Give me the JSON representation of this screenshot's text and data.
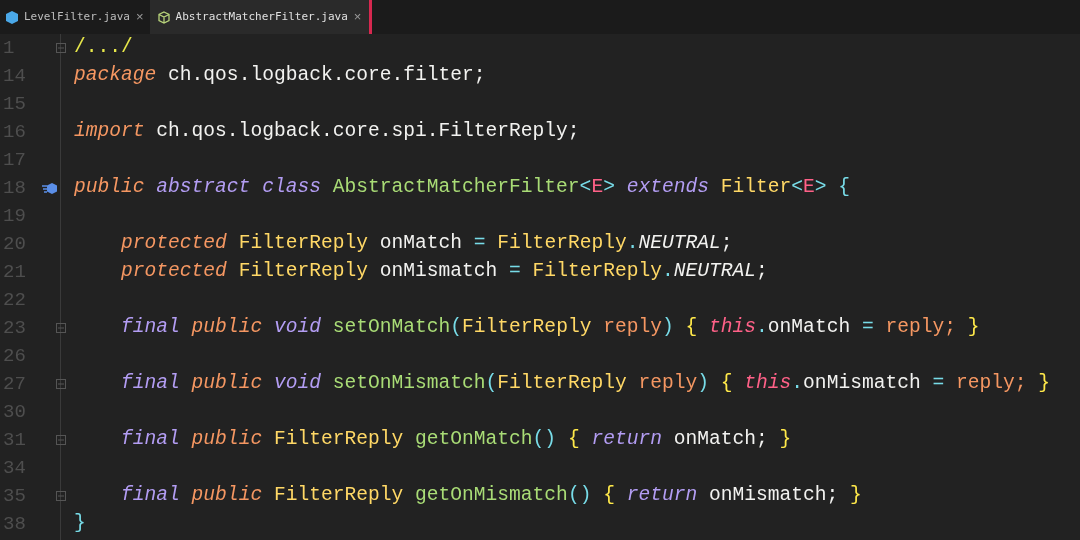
{
  "tabs": [
    {
      "label": "LevelFilter.java",
      "kind": "filled",
      "close": "×",
      "selected": false
    },
    {
      "label": "AbstractMatcherFilter.java",
      "kind": "outline",
      "close": "×",
      "selected": true
    }
  ],
  "lines": [
    {
      "num": "1",
      "fold": true,
      "tokens": [
        {
          "kind": "fold",
          "t": "/.../"
        }
      ]
    },
    {
      "num": "14",
      "tokens": [
        {
          "kind": "kw",
          "t": "package "
        },
        {
          "kind": "id",
          "t": "ch.qos.logback.core.filter;"
        }
      ]
    },
    {
      "num": "15"
    },
    {
      "num": "16",
      "tokens": [
        {
          "kind": "kw",
          "t": "import "
        },
        {
          "kind": "id",
          "t": "ch.qos.logback.core.spi.FilterReply;"
        }
      ]
    },
    {
      "num": "17"
    },
    {
      "num": "18",
      "marker": true,
      "tokens": [
        {
          "kind": "kw",
          "t": "public "
        },
        {
          "kind": "mod",
          "t": "abstract class "
        },
        {
          "kind": "cls",
          "t": "AbstractMatcherFilter"
        },
        {
          "kind": "op",
          "t": "<"
        },
        {
          "kind": "tp",
          "t": "E"
        },
        {
          "kind": "op",
          "t": "> "
        },
        {
          "kind": "mod",
          "t": "extends "
        },
        {
          "kind": "type",
          "t": "Filter"
        },
        {
          "kind": "op",
          "t": "<"
        },
        {
          "kind": "tp",
          "t": "E"
        },
        {
          "kind": "op",
          "t": "> {"
        }
      ]
    },
    {
      "num": "19"
    },
    {
      "num": "20",
      "tokens": [
        {
          "kind": "kw",
          "t": "    protected "
        },
        {
          "kind": "type",
          "t": "FilterReply "
        },
        {
          "kind": "id",
          "t": "onMatch "
        },
        {
          "kind": "op",
          "t": "= "
        },
        {
          "kind": "type",
          "t": "FilterReply"
        },
        {
          "kind": "op",
          "t": "."
        },
        {
          "kind": "const",
          "t": "NEUTRAL"
        },
        {
          "kind": "id",
          "t": ";"
        }
      ]
    },
    {
      "num": "21",
      "tokens": [
        {
          "kind": "kw",
          "t": "    protected "
        },
        {
          "kind": "type",
          "t": "FilterReply "
        },
        {
          "kind": "id",
          "t": "onMismatch "
        },
        {
          "kind": "op",
          "t": "= "
        },
        {
          "kind": "type",
          "t": "FilterReply"
        },
        {
          "kind": "op",
          "t": "."
        },
        {
          "kind": "const",
          "t": "NEUTRAL"
        },
        {
          "kind": "id",
          "t": ";"
        }
      ]
    },
    {
      "num": "22"
    },
    {
      "num": "23",
      "fold": true,
      "tokens": [
        {
          "kind": "mod",
          "t": "    final "
        },
        {
          "kind": "kw",
          "t": "public "
        },
        {
          "kind": "mod",
          "t": "void "
        },
        {
          "kind": "cls",
          "t": "setOnMatch"
        },
        {
          "kind": "op",
          "t": "("
        },
        {
          "kind": "type",
          "t": "FilterReply "
        },
        {
          "kind": "param",
          "t": "reply"
        },
        {
          "kind": "op",
          "t": ") "
        },
        {
          "kind": "brace",
          "t": "{ "
        },
        {
          "kind": "this",
          "t": "this"
        },
        {
          "kind": "op",
          "t": "."
        },
        {
          "kind": "id",
          "t": "onMatch "
        },
        {
          "kind": "op",
          "t": "= "
        },
        {
          "kind": "param",
          "t": "reply; "
        },
        {
          "kind": "brace",
          "t": "}"
        }
      ]
    },
    {
      "num": "26"
    },
    {
      "num": "27",
      "fold": true,
      "tokens": [
        {
          "kind": "mod",
          "t": "    final "
        },
        {
          "kind": "kw",
          "t": "public "
        },
        {
          "kind": "mod",
          "t": "void "
        },
        {
          "kind": "cls",
          "t": "setOnMismatch"
        },
        {
          "kind": "op",
          "t": "("
        },
        {
          "kind": "type",
          "t": "FilterReply "
        },
        {
          "kind": "param",
          "t": "reply"
        },
        {
          "kind": "op",
          "t": ") "
        },
        {
          "kind": "brace",
          "t": "{ "
        },
        {
          "kind": "this",
          "t": "this"
        },
        {
          "kind": "op",
          "t": "."
        },
        {
          "kind": "id",
          "t": "onMismatch "
        },
        {
          "kind": "op",
          "t": "= "
        },
        {
          "kind": "param",
          "t": "reply; "
        },
        {
          "kind": "brace",
          "t": "}"
        }
      ]
    },
    {
      "num": "30"
    },
    {
      "num": "31",
      "fold": true,
      "tokens": [
        {
          "kind": "mod",
          "t": "    final "
        },
        {
          "kind": "kw",
          "t": "public "
        },
        {
          "kind": "type",
          "t": "FilterReply "
        },
        {
          "kind": "cls",
          "t": "getOnMatch"
        },
        {
          "kind": "op",
          "t": "() "
        },
        {
          "kind": "brace",
          "t": "{ "
        },
        {
          "kind": "mod",
          "t": "return "
        },
        {
          "kind": "id",
          "t": "onMatch; "
        },
        {
          "kind": "brace",
          "t": "}"
        }
      ]
    },
    {
      "num": "34"
    },
    {
      "num": "35",
      "fold": true,
      "tokens": [
        {
          "kind": "mod",
          "t": "    final "
        },
        {
          "kind": "kw",
          "t": "public "
        },
        {
          "kind": "type",
          "t": "FilterReply "
        },
        {
          "kind": "cls",
          "t": "getOnMismatch"
        },
        {
          "kind": "op",
          "t": "() "
        },
        {
          "kind": "brace",
          "t": "{ "
        },
        {
          "kind": "mod",
          "t": "return "
        },
        {
          "kind": "id",
          "t": "onMismatch; "
        },
        {
          "kind": "brace",
          "t": "}"
        }
      ]
    },
    {
      "num": "38",
      "tokens": [
        {
          "kind": "op",
          "t": "}"
        }
      ]
    }
  ]
}
